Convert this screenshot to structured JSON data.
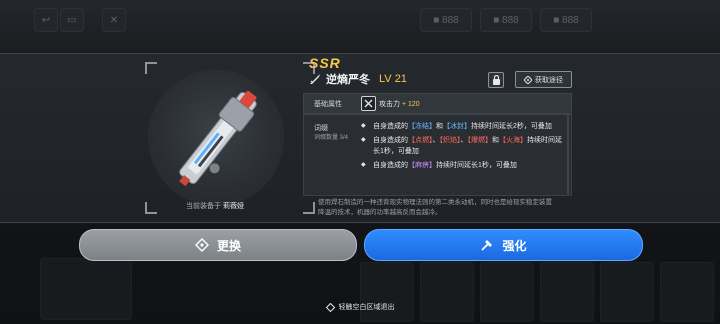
{
  "colors": {
    "rarity": "#f6c94a",
    "ice": "#66b8ff",
    "fire": "#ff6b5b",
    "lightning": "#c48cff",
    "primary_button": "#2f8cff"
  },
  "weapon": {
    "rarity": "SSR",
    "name": "逆熵严冬",
    "level": "LV 21",
    "equipped_prefix": "当前装备于",
    "equipped_by": "莉薇娅",
    "source_label": "获取途径",
    "icons": {
      "weapon_type": "sword-icon",
      "lock": "lock-icon",
      "source": "diamond-icon"
    }
  },
  "base_attr": {
    "label": "基础属性",
    "stat": "攻击力",
    "bonus": "+ 120"
  },
  "affix": {
    "title": "词缀",
    "count": "词缀数量 3/4",
    "items": [
      {
        "a": "自身造成的",
        "k1": "【冻结】",
        "b": "和",
        "k2": "【冰封】",
        "c": "持续时间延长2秒，可叠加"
      },
      {
        "a": "自身造成的",
        "k1": "【点燃】",
        "b": "、",
        "k2": "【炽焰】",
        "c": "、",
        "k3": "【爆燃】",
        "d": "和",
        "k4": "【火海】",
        "e": "持续时间延长1秒，可叠加"
      },
      {
        "a": "自身造成的",
        "k1": "【麻痹】",
        "c": "持续时间延长1秒，可叠加"
      }
    ]
  },
  "description": "使用焊石制造的一种违背现实物理法则的第二类永动机，同时也是给现实稳定装置降温的技术，机器的功率越高反而会越冷。",
  "buttons": {
    "swap": "更换",
    "upgrade": "强化"
  },
  "hint": "轻触空白区域退出",
  "topbar": {
    "left_icon": "back-icon",
    "item1": "■ 888",
    "item2": "■ 888",
    "item3": "■ 888"
  }
}
